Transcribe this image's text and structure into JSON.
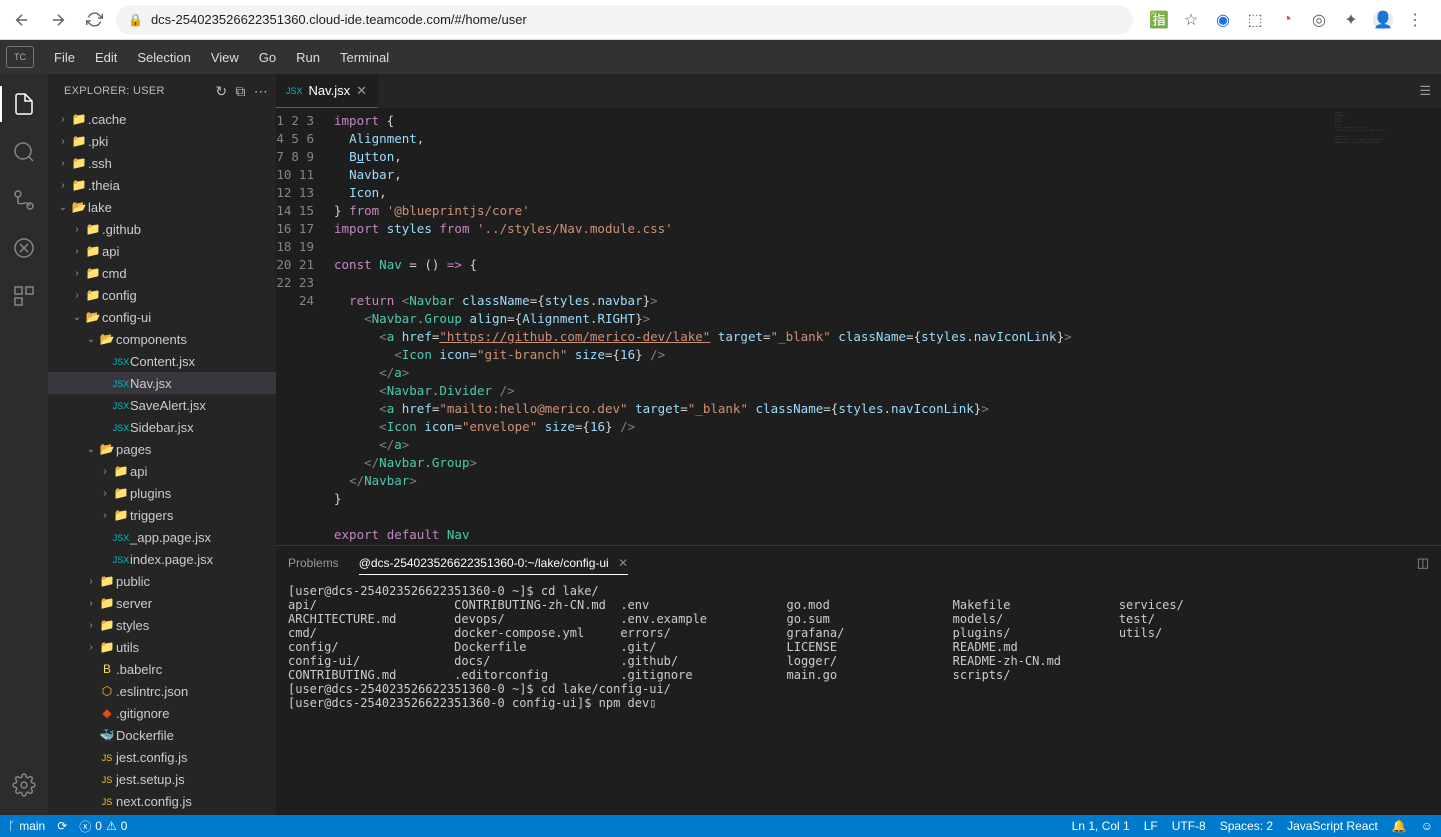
{
  "browser": {
    "url": "dcs-254023526622351360.cloud-ide.teamcode.com/#/home/user"
  },
  "menubar": {
    "logo": "TC",
    "items": [
      "File",
      "Edit",
      "Selection",
      "View",
      "Go",
      "Run",
      "Terminal"
    ]
  },
  "sidebar": {
    "title": "EXPLORER: USER"
  },
  "fileTree": [
    {
      "depth": 0,
      "type": "folder",
      "open": false,
      "name": ".cache"
    },
    {
      "depth": 0,
      "type": "folder",
      "open": false,
      "name": ".pki"
    },
    {
      "depth": 0,
      "type": "folder",
      "open": false,
      "name": ".ssh"
    },
    {
      "depth": 0,
      "type": "folder",
      "open": false,
      "name": ".theia"
    },
    {
      "depth": 0,
      "type": "folder",
      "open": true,
      "name": "lake"
    },
    {
      "depth": 1,
      "type": "folder",
      "open": false,
      "name": ".github"
    },
    {
      "depth": 1,
      "type": "folder",
      "open": false,
      "name": "api"
    },
    {
      "depth": 1,
      "type": "folder",
      "open": false,
      "name": "cmd"
    },
    {
      "depth": 1,
      "type": "folder",
      "open": false,
      "name": "config"
    },
    {
      "depth": 1,
      "type": "folder",
      "open": true,
      "name": "config-ui"
    },
    {
      "depth": 2,
      "type": "folder",
      "open": true,
      "name": "components"
    },
    {
      "depth": 3,
      "type": "file",
      "icon": "jsx",
      "name": "Content.jsx"
    },
    {
      "depth": 3,
      "type": "file",
      "icon": "jsx",
      "name": "Nav.jsx",
      "selected": true
    },
    {
      "depth": 3,
      "type": "file",
      "icon": "jsx",
      "name": "SaveAlert.jsx"
    },
    {
      "depth": 3,
      "type": "file",
      "icon": "jsx",
      "name": "Sidebar.jsx"
    },
    {
      "depth": 2,
      "type": "folder",
      "open": true,
      "name": "pages"
    },
    {
      "depth": 3,
      "type": "folder",
      "open": false,
      "name": "api"
    },
    {
      "depth": 3,
      "type": "folder",
      "open": false,
      "name": "plugins"
    },
    {
      "depth": 3,
      "type": "folder",
      "open": false,
      "name": "triggers"
    },
    {
      "depth": 3,
      "type": "file",
      "icon": "jsx",
      "name": "_app.page.jsx"
    },
    {
      "depth": 3,
      "type": "file",
      "icon": "jsx",
      "name": "index.page.jsx"
    },
    {
      "depth": 2,
      "type": "folder",
      "open": false,
      "name": "public"
    },
    {
      "depth": 2,
      "type": "folder",
      "open": false,
      "name": "server"
    },
    {
      "depth": 2,
      "type": "folder",
      "open": false,
      "name": "styles"
    },
    {
      "depth": 2,
      "type": "folder",
      "open": false,
      "name": "utils"
    },
    {
      "depth": 2,
      "type": "file",
      "icon": "babel",
      "name": ".babelrc"
    },
    {
      "depth": 2,
      "type": "file",
      "icon": "json",
      "name": ".eslintrc.json"
    },
    {
      "depth": 2,
      "type": "file",
      "icon": "git",
      "name": ".gitignore"
    },
    {
      "depth": 2,
      "type": "file",
      "icon": "docker",
      "name": "Dockerfile"
    },
    {
      "depth": 2,
      "type": "file",
      "icon": "js",
      "name": "jest.config.js"
    },
    {
      "depth": 2,
      "type": "file",
      "icon": "js",
      "name": "jest.setup.js"
    },
    {
      "depth": 2,
      "type": "file",
      "icon": "js",
      "name": "next.config.js"
    }
  ],
  "editor": {
    "tab": "Nav.jsx",
    "lineCount": 24
  },
  "panel": {
    "tabProblems": "Problems",
    "tabTerminal": "@dcs-254023526622351360-0:~/lake/config-ui",
    "terminal": "[user@dcs-254023526622351360-0 ~]$ cd lake/\napi/                   CONTRIBUTING-zh-CN.md  .env                   go.mod                 Makefile               services/\nARCHITECTURE.md        devops/                .env.example           go.sum                 models/                test/\ncmd/                   docker-compose.yml     errors/                grafana/               plugins/               utils/\nconfig/                Dockerfile             .git/                  LICENSE                README.md\nconfig-ui/             docs/                  .github/               logger/                README-zh-CN.md\nCONTRIBUTING.md        .editorconfig          .gitignore             main.go                scripts/\n[user@dcs-254023526622351360-0 ~]$ cd lake/config-ui/\n[user@dcs-254023526622351360-0 config-ui]$ npm dev▯"
  },
  "statusBar": {
    "branch": "main",
    "errors": "0",
    "warnings": "0",
    "cursor": "Ln 1, Col 1",
    "eol": "LF",
    "encoding": "UTF-8",
    "spaces": "Spaces: 2",
    "language": "JavaScript React"
  }
}
